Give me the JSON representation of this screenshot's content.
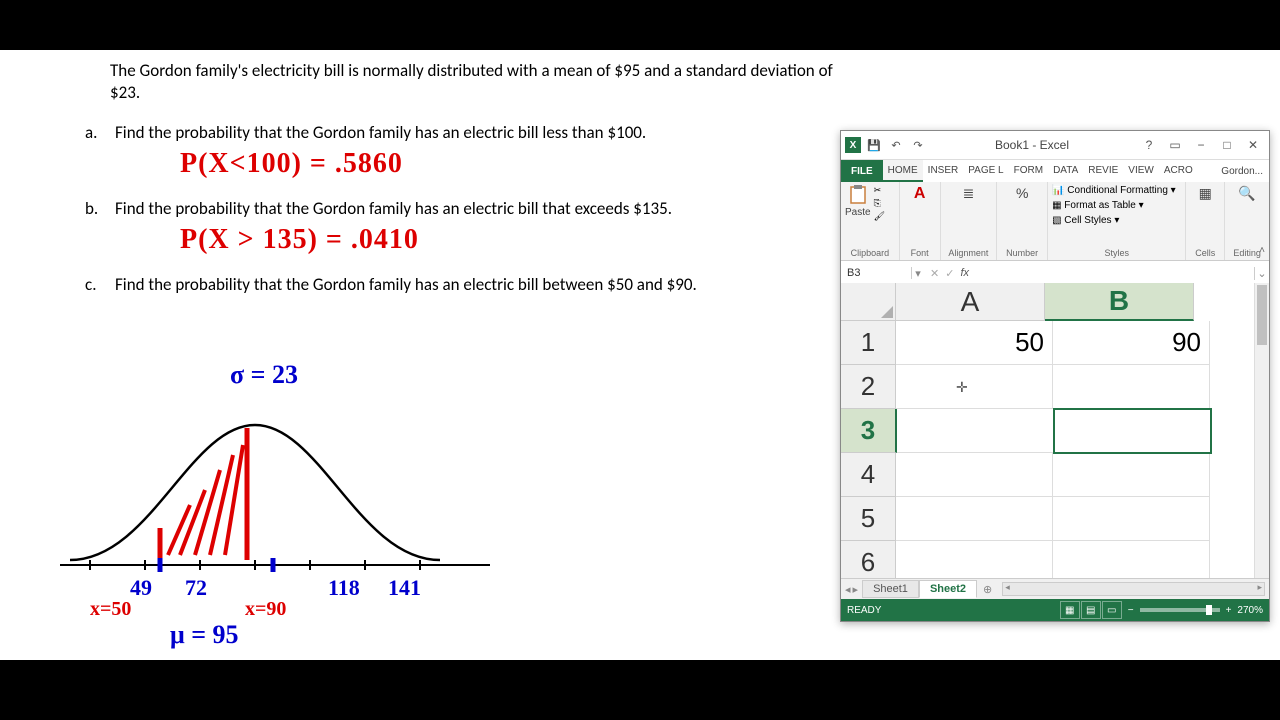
{
  "problem": {
    "intro": "The Gordon family's electricity bill is normally distributed with a mean of $95 and a standard deviation of $23.",
    "a_label": "a.",
    "a_text": "Find the probability that the Gordon family has an electric bill less than $100.",
    "a_answer": "P(X<100) =  .5860",
    "b_label": "b.",
    "b_text": "Find the probability that the Gordon family has an electric bill that exceeds $135.",
    "b_answer": "P(X > 135) =   .0410",
    "c_label": "c.",
    "c_text": "Find the probability that the Gordon family has an electric bill between $50 and $90.",
    "sigma_label": "σ = 23",
    "axis": {
      "v49": "49",
      "v72": "72",
      "v118": "118",
      "v141": "141"
    },
    "x50": "x=50",
    "x90": "x=90",
    "mu_label": "μ = 95"
  },
  "excel": {
    "title": "Book1 - Excel",
    "user": "Gordon...",
    "tabs": {
      "file": "FILE",
      "home": "HOME",
      "insert": "INSER",
      "pagel": "PAGE L",
      "form": "FORM",
      "data": "DATA",
      "revie": "REVIE",
      "view": "VIEW",
      "acro": "ACRO"
    },
    "ribbon": {
      "paste": "Paste",
      "clipboard": "Clipboard",
      "font": "Font",
      "alignment": "Alignment",
      "number": "Number",
      "cond_fmt": "Conditional Formatting",
      "fmt_table": "Format as Table",
      "cell_styles": "Cell Styles",
      "styles": "Styles",
      "cells": "Cells",
      "editing": "Editing"
    },
    "name_box": "B3",
    "fx": "fx",
    "columns": [
      "A",
      "B"
    ],
    "rows": [
      "1",
      "2",
      "3",
      "4",
      "5",
      "6"
    ],
    "cells": {
      "A1": "50",
      "B1": "90"
    },
    "selected_col": "B",
    "selected_row": "3",
    "sheets": {
      "s1": "Sheet1",
      "s2": "Sheet2"
    },
    "status": "READY",
    "zoom": "270%"
  }
}
